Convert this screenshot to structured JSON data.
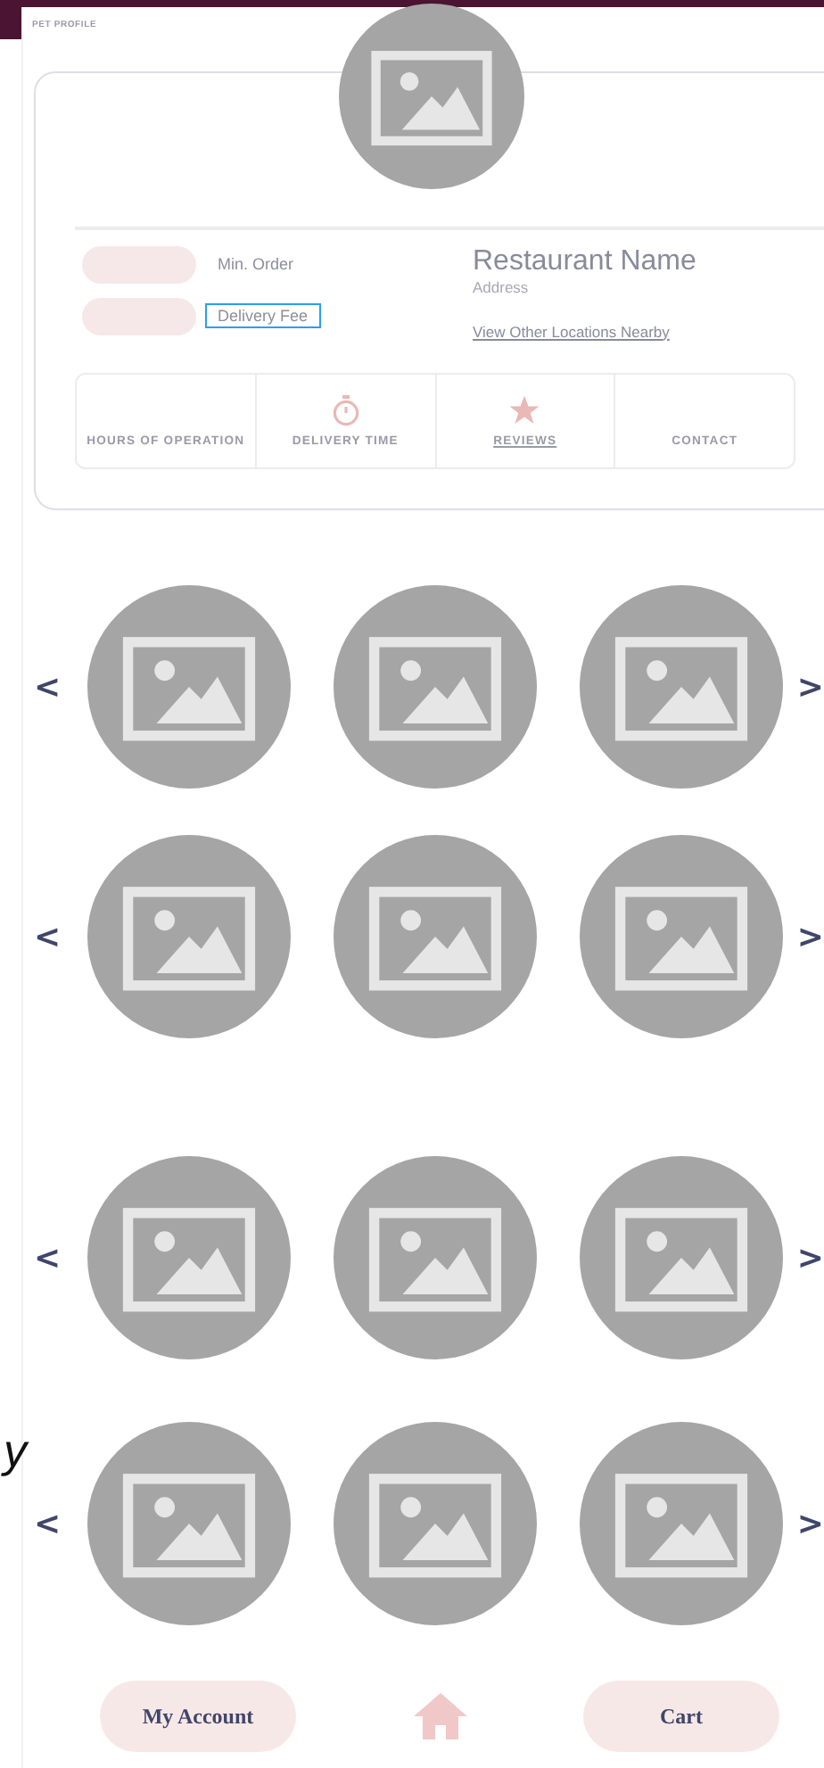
{
  "header": {
    "title": "PET PROFILE"
  },
  "restaurant": {
    "name": "Restaurant Name",
    "address": "Address",
    "link": "View Other Locations Nearby"
  },
  "fees": [
    {
      "label": "Min. Order",
      "selected": false
    },
    {
      "label": "Delivery Fee",
      "selected": true
    }
  ],
  "tabs": [
    {
      "label": "HOURS OF OPERATION",
      "kind": "plain",
      "selected": false
    },
    {
      "label": "DELIVERY TIME",
      "kind": "timer",
      "selected": false
    },
    {
      "label": "REVIEWS",
      "kind": "star",
      "selected": true
    },
    {
      "label": "CONTACT",
      "kind": "plain",
      "selected": false
    }
  ],
  "carousels": [
    {
      "prev": "<",
      "next": ">",
      "items": [
        {
          "kind": "placeholder"
        },
        {
          "kind": "placeholder"
        },
        {
          "kind": "placeholder"
        }
      ]
    },
    {
      "prev": "<",
      "next": ">",
      "items": [
        {
          "kind": "placeholder"
        },
        {
          "kind": "placeholder"
        },
        {
          "kind": "placeholder"
        }
      ]
    },
    {
      "prev": "<",
      "next": ">",
      "items": [
        {
          "kind": "placeholder"
        },
        {
          "kind": "placeholder"
        },
        {
          "kind": "placeholder"
        }
      ]
    },
    {
      "prev": "<",
      "next": ">",
      "items": [
        {
          "kind": "placeholder"
        },
        {
          "kind": "placeholder"
        },
        {
          "kind": "placeholder"
        }
      ]
    }
  ],
  "stray_text": "y",
  "nav": {
    "account": "My Account",
    "cart": "Cart"
  }
}
